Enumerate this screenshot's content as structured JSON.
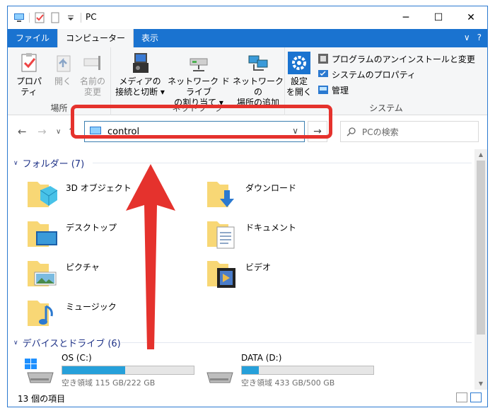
{
  "window": {
    "title": "PC"
  },
  "window_controls": {
    "minimize": "─",
    "maximize": "☐",
    "close": "✕"
  },
  "ribbon_tabs": [
    {
      "label": "ファイル"
    },
    {
      "label": "コンピューター"
    },
    {
      "label": "表示"
    }
  ],
  "ribbon_right": {
    "expand": "∨",
    "help": "?"
  },
  "ribbon": {
    "groups": {
      "location": {
        "label": "場所"
      },
      "network": {
        "label": "ネットワーク"
      },
      "system": {
        "label": "システム"
      }
    },
    "buttons": {
      "properties": {
        "line1": "プロパティ",
        "line2": ""
      },
      "open": {
        "line1": "開く",
        "line2": ""
      },
      "rename": {
        "line1": "名前の",
        "line2": "変更"
      },
      "media": {
        "line1": "メディアの",
        "line2": "接続と切断 ▾"
      },
      "map_drive": {
        "line1": "ネットワーク ドライブ",
        "line2": "の割り当て ▾"
      },
      "add_location": {
        "line1": "ネットワークの",
        "line2": "場所の追加"
      },
      "settings": {
        "line1": "設定",
        "line2": "を開く"
      }
    },
    "small": {
      "uninstall": "プログラムのアンインストールと変更",
      "sys_props": "システムのプロパティ",
      "manage": "管理"
    }
  },
  "address": {
    "back": "←",
    "forward": "→",
    "recent": "∨",
    "up": "↑",
    "value": "control",
    "dropdown": "∨",
    "go": "→",
    "search_placeholder": "PCの検索"
  },
  "folders_section": {
    "label": "フォルダー (7)"
  },
  "folders": [
    {
      "name": "3D オブジェクト",
      "icon": "3d-objects-icon"
    },
    {
      "name": "ダウンロード",
      "icon": "downloads-icon"
    },
    {
      "name": "デスクトップ",
      "icon": "desktop-icon"
    },
    {
      "name": "ドキュメント",
      "icon": "documents-icon"
    },
    {
      "name": "ピクチャ",
      "icon": "pictures-icon"
    },
    {
      "name": "ビデオ",
      "icon": "videos-icon"
    },
    {
      "name": "ミュージック",
      "icon": "music-icon"
    }
  ],
  "drives_section": {
    "label": "デバイスとドライブ (6)"
  },
  "drives": [
    {
      "name": "OS (C:)",
      "free": "空き領域 115 GB/222 GB",
      "used_fraction": 0.48
    },
    {
      "name": "DATA (D:)",
      "free": "空き領域 433 GB/500 GB",
      "used_fraction": 0.13
    }
  ],
  "status": {
    "count": "13 個の項目"
  },
  "colors": {
    "accent": "#1a73d0",
    "highlight": "#e5322d",
    "drive_fill": "#26a0da",
    "folder": "#f8d775"
  }
}
